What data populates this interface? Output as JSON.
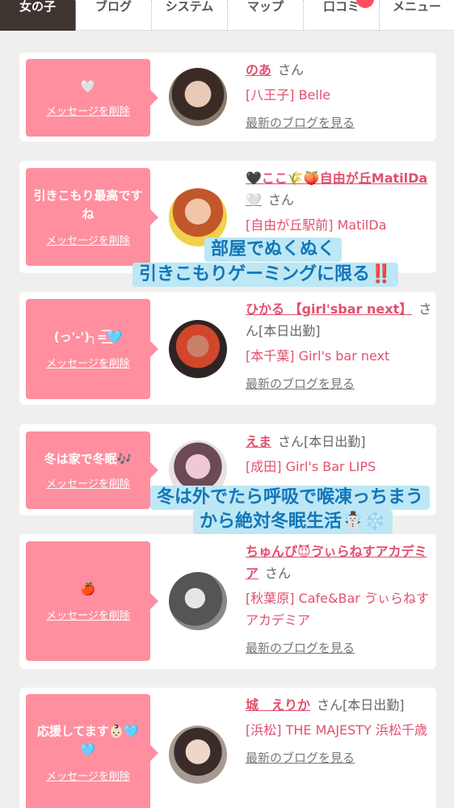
{
  "nav": {
    "tabs": [
      {
        "label": "女の子",
        "active": true
      },
      {
        "label": "ブログ"
      },
      {
        "label": "システム"
      },
      {
        "label": "マップ"
      },
      {
        "label": "口コミ",
        "badge": true
      },
      {
        "label": "メニュー"
      }
    ]
  },
  "cards": [
    {
      "bubble": {
        "message": "🤍",
        "delete_label": "メッセージを削除"
      },
      "name": "のあ",
      "suffix": "さん",
      "status": "",
      "shop": "[八王子] Belle",
      "blog_link": "最新のブログを見る"
    },
    {
      "bubble": {
        "message": "引きこもり最高ですね",
        "delete_label": "メッセージを削除"
      },
      "name": "🖤ここ🌾🍑自由が丘MatilDa🤍",
      "suffix": "さん",
      "status": "",
      "shop": "[自由が丘駅前] MatilDa",
      "blog_link": ""
    },
    {
      "bubble": {
        "message": "(っ'-')╮=͟͟͞͞🩵",
        "delete_label": "メッセージを削除"
      },
      "name": "ひかる 【girl'sbar next】",
      "suffix": "さん",
      "status": "[本日出勤]",
      "shop": "[本千葉] Girl's bar next",
      "blog_link": "最新のブログを見る"
    },
    {
      "bubble": {
        "message": "冬は家で冬眠🎶",
        "delete_label": "メッセージを削除"
      },
      "name": "えま",
      "suffix": "さん",
      "status": "[本日出勤]",
      "shop": "[成田] Girl's Bar LIPS",
      "blog_link": ""
    },
    {
      "bubble": {
        "message": "🍎",
        "delete_label": "メッセージを削除"
      },
      "name": "ちゅんぴ😈ゔぃらねすアカデミア",
      "suffix": "さん",
      "status": "",
      "shop": "[秋葉原] Cafe&Bar ゔぃらねすアカデミア",
      "blog_link": "最新のブログを見る"
    },
    {
      "bubble": {
        "message": "応援してます👶🏻🩵🩵",
        "delete_label": "メッセージを削除"
      },
      "name": "城　えりか",
      "suffix": "さん",
      "status": "[本日出勤]",
      "shop": "[浜松] THE MAJESTY 浜松千歳",
      "blog_link": "最新のブログを見る"
    }
  ],
  "captions": {
    "c1_line1": "部屋でぬくぬく",
    "c1_line2": "引きこもりゲーミングに限る‼️",
    "c2_line1": "冬は外でたら呼吸で喉凍っちまう",
    "c2_line2": "から絶対冬眠生活☃️❄️"
  },
  "colors": {
    "bubble": "#ff8f9f",
    "name": "#e2506e",
    "caption_bg": "#bde7f5",
    "caption_text": "#1276b8",
    "active_tab": "#3f3530"
  }
}
